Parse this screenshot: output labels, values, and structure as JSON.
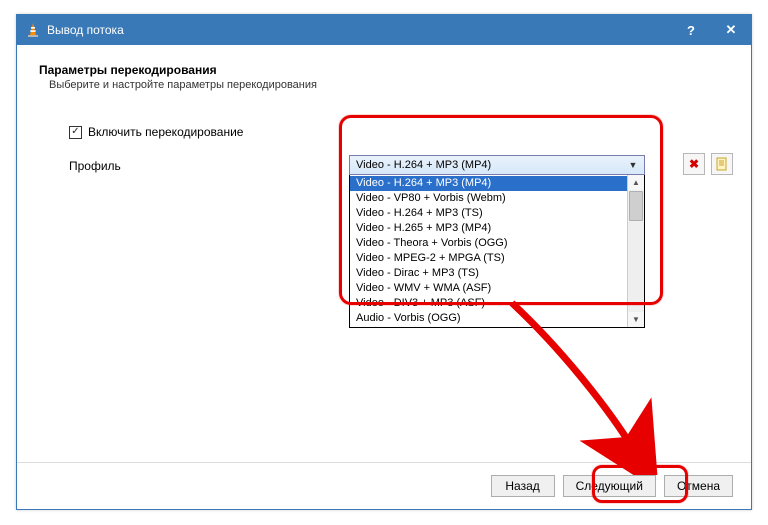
{
  "titlebar": {
    "title": "Вывод потока",
    "help": "?",
    "close": "✕"
  },
  "section": {
    "heading": "Параметры перекодирования",
    "subheading": "Выберите и настройте параметры перекодирования"
  },
  "transcode": {
    "checkmark": "✓",
    "label": "Включить перекодирование"
  },
  "profile": {
    "label": "Профиль",
    "selected": "Video - H.264 + MP3 (MP4)",
    "arrow": "▼",
    "options": [
      "Video - H.264 + MP3 (MP4)",
      "Video - VP80 + Vorbis (Webm)",
      "Video - H.264 + MP3 (TS)",
      "Video - H.265 + MP3 (MP4)",
      "Video - Theora + Vorbis (OGG)",
      "Video - MPEG-2 + MPGA (TS)",
      "Video - Dirac + MP3 (TS)",
      "Video - WMV + WMA (ASF)",
      "Video - DIV3 + MP3 (ASF)",
      "Audio - Vorbis (OGG)"
    ],
    "scroll_up": "▲",
    "scroll_down": "▼"
  },
  "side": {
    "delete": "✖"
  },
  "buttons": {
    "back": "Назад",
    "next": "Следующий",
    "cancel": "Отмена"
  }
}
